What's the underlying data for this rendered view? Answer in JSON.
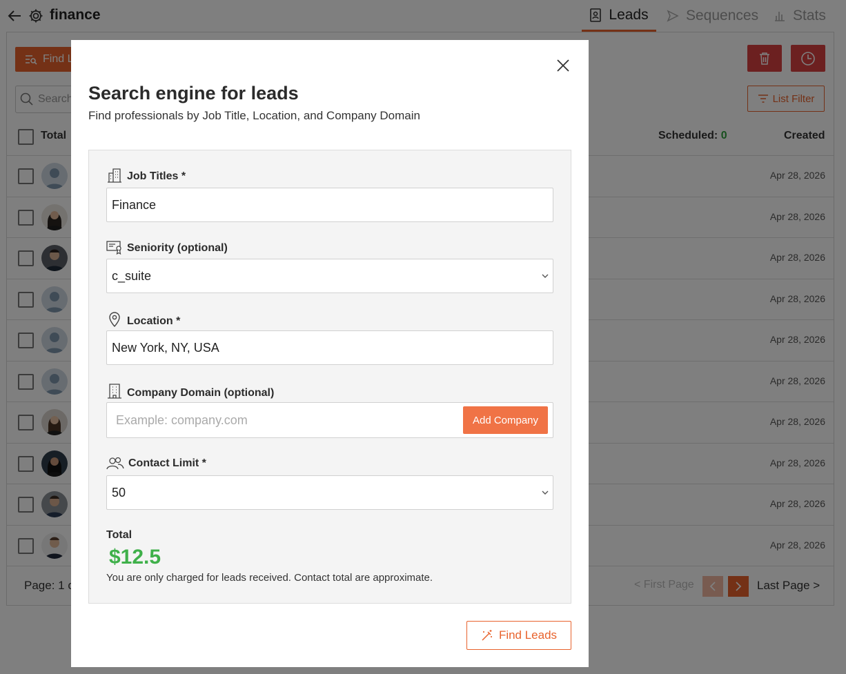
{
  "header": {
    "list_name": "finance",
    "tabs": [
      {
        "label": "Leads",
        "active": true
      },
      {
        "label": "Sequences",
        "active": false
      },
      {
        "label": "Stats",
        "active": false
      }
    ]
  },
  "toolbar": {
    "find_leads_label": "Find L",
    "search_placeholder": "Search",
    "list_filter_label": "List Filter"
  },
  "table": {
    "col_total": "Total",
    "col_scheduled": "Scheduled:",
    "scheduled_count": "0",
    "col_created": "Created",
    "rows": [
      {
        "created": "Apr 28, 2026",
        "avatar": "placeholder"
      },
      {
        "created": "Apr 28, 2026",
        "avatar": "photo"
      },
      {
        "created": "Apr 28, 2026",
        "avatar": "photo"
      },
      {
        "created": "Apr 28, 2026",
        "avatar": "placeholder"
      },
      {
        "created": "Apr 28, 2026",
        "avatar": "placeholder"
      },
      {
        "created": "Apr 28, 2026",
        "avatar": "placeholder"
      },
      {
        "created": "Apr 28, 2026",
        "avatar": "photo"
      },
      {
        "created": "Apr 28, 2026",
        "avatar": "photo"
      },
      {
        "created": "Apr 28, 2026",
        "avatar": "photo"
      },
      {
        "created": "Apr 28, 2026",
        "avatar": "photo"
      }
    ]
  },
  "pagination": {
    "page_label": "Page: 1 o",
    "first_page": "< First Page",
    "last_page": "Last Page >"
  },
  "modal": {
    "title": "Search engine for leads",
    "subtitle": "Find professionals by Job Title, Location, and Company Domain",
    "job_titles": {
      "label": "Job Titles *",
      "value": "Finance"
    },
    "seniority": {
      "label": "Seniority (optional)",
      "value": "c_suite"
    },
    "location": {
      "label": "Location *",
      "value": "New York, NY, USA"
    },
    "company_domain": {
      "label": "Company Domain (optional)",
      "placeholder": "Example: company.com",
      "add_button": "Add Company"
    },
    "contact_limit": {
      "label": "Contact Limit *",
      "value": "50"
    },
    "total_label": "Total",
    "total_value": "$12.5",
    "total_note": "You are only charged for leads received. Contact total are approximate.",
    "submit_label": "Find Leads"
  },
  "colors": {
    "accent": "#e8622c",
    "danger": "#d94040",
    "success": "#3fb04a"
  }
}
